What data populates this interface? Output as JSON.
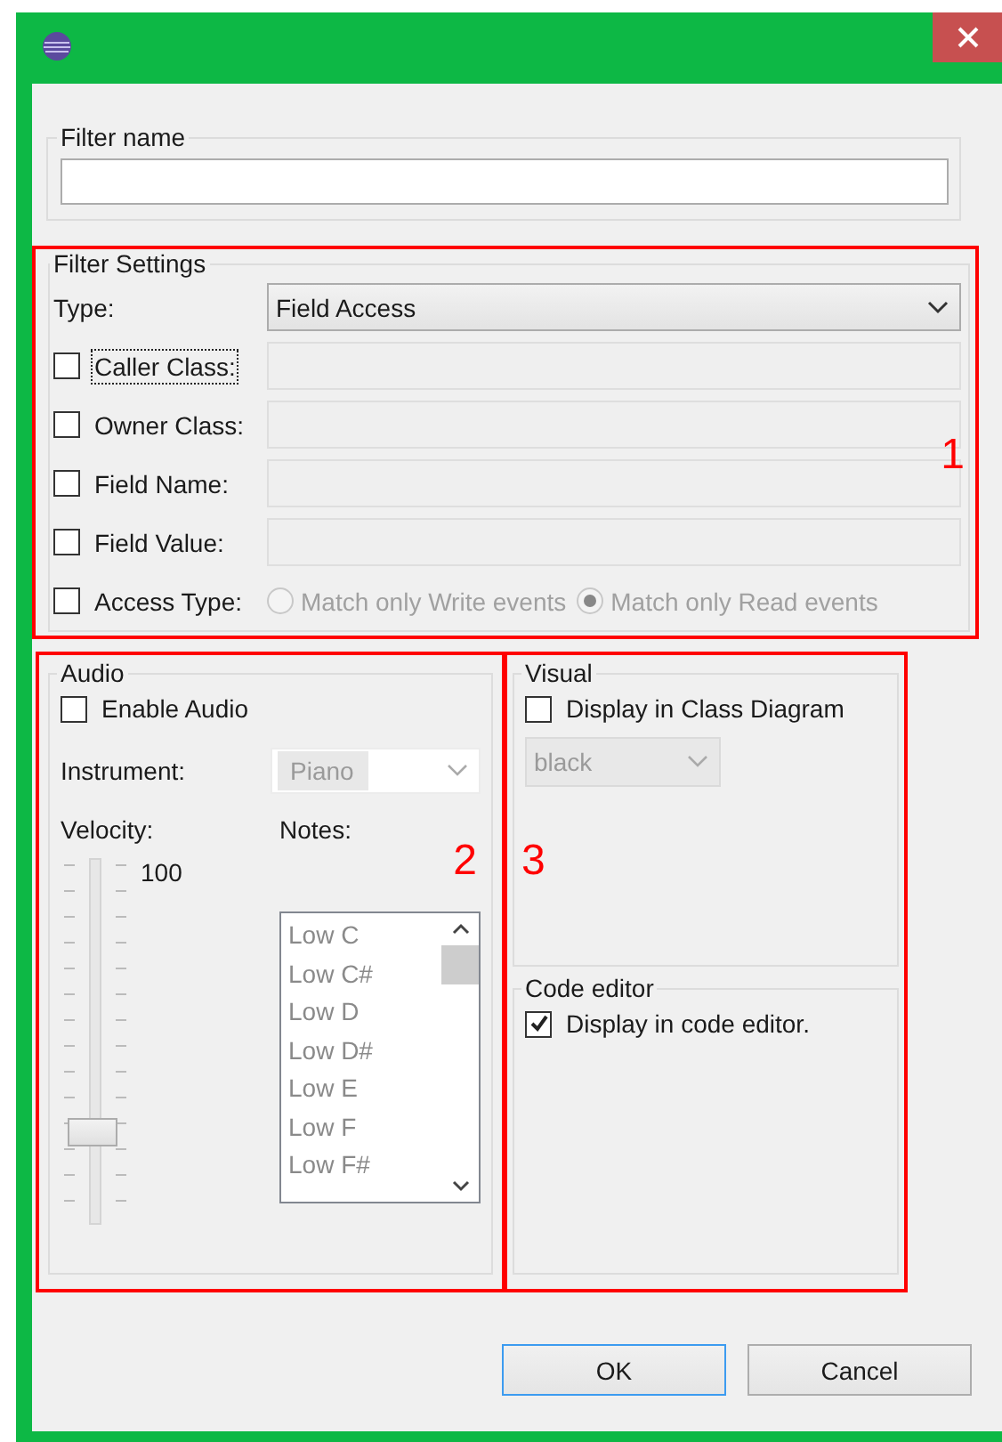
{
  "filter_name": {
    "label": "Filter name"
  },
  "filter_settings": {
    "title": "Filter Settings",
    "annotation": "1",
    "type": {
      "label": "Type:",
      "value": "Field Access"
    },
    "fields": [
      {
        "label": "Caller Class:",
        "checked": false,
        "focused": true,
        "disabled": true
      },
      {
        "label": "Owner Class:",
        "checked": false,
        "focused": false,
        "disabled": true
      },
      {
        "label": "Field Name:",
        "checked": false,
        "focused": false,
        "disabled": true
      },
      {
        "label": "Field Value:",
        "checked": false,
        "focused": false,
        "disabled": true
      }
    ],
    "access_type": {
      "label": "Access Type:",
      "checked": false,
      "options": [
        {
          "label": "Match only Write events",
          "selected": false,
          "disabled": true
        },
        {
          "label": "Match only Read events",
          "selected": true,
          "disabled": true
        }
      ]
    }
  },
  "audio": {
    "title": "Audio",
    "annotation": "2",
    "enable": {
      "label": "Enable Audio",
      "checked": false
    },
    "instrument": {
      "label": "Instrument:",
      "value": "Piano",
      "disabled": true
    },
    "velocity": {
      "label": "Velocity:",
      "reading": "100",
      "level": 0.24
    },
    "notes": {
      "label": "Notes:",
      "disabled": true,
      "items": [
        {
          "label": "Low C"
        },
        {
          "label": "Low C#"
        },
        {
          "label": "Low D"
        },
        {
          "label": "Low D#"
        },
        {
          "label": "Low E"
        },
        {
          "label": "Low F"
        },
        {
          "label": "Low F#"
        }
      ]
    }
  },
  "side_panel": {
    "annotation": "3",
    "visual": {
      "title": "Visual",
      "display": {
        "label": "Display in Class Diagram",
        "checked": false
      },
      "color": {
        "value": "black",
        "disabled": true
      }
    },
    "code_editor": {
      "title": "Code editor",
      "display": {
        "label": "Display in code editor.",
        "checked": true
      }
    }
  },
  "buttons": [
    {
      "label": "OK",
      "default": true
    },
    {
      "label": "Cancel",
      "default": false
    }
  ]
}
